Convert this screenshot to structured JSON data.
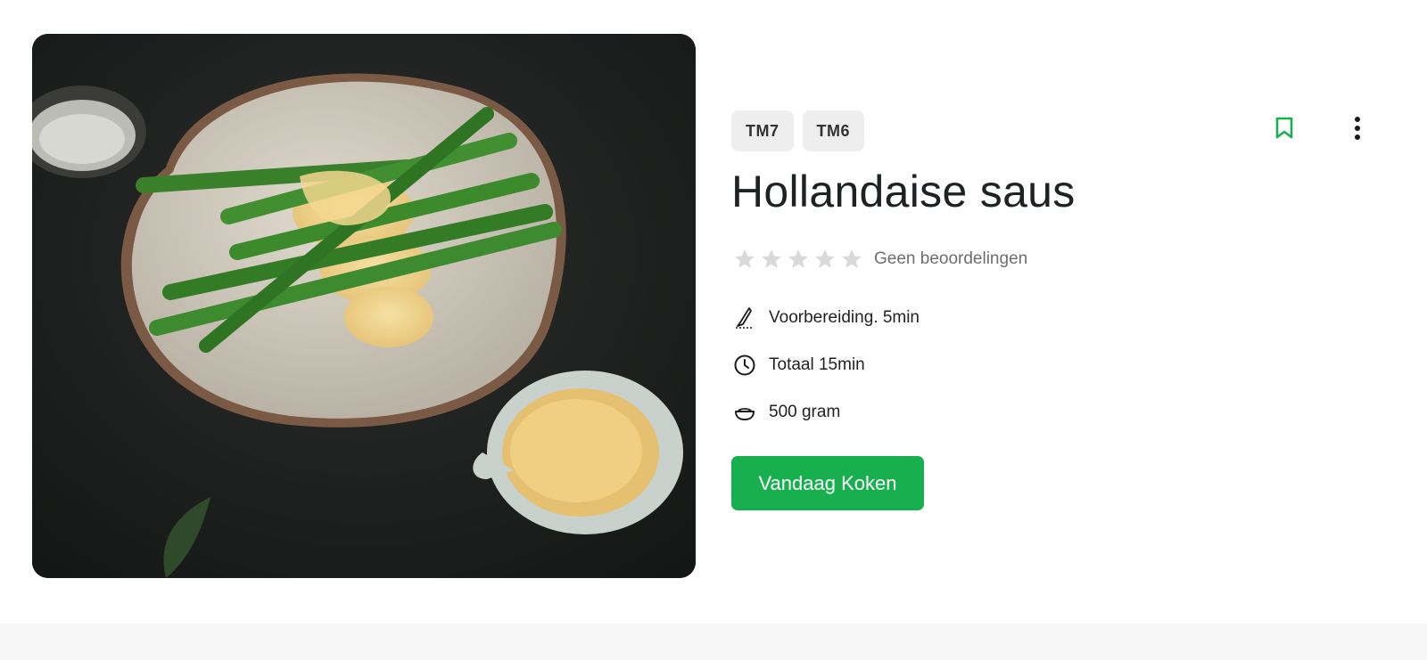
{
  "hero_image": {
    "alt": "Hollandaise saus",
    "colors": {
      "background": "#1d1f1e",
      "plate": "#d9d2c6",
      "asparagus": "#3f8a2e",
      "sauce": "#f1d58e"
    }
  },
  "recipe": {
    "tags": [
      "TM7",
      "TM6"
    ],
    "title": "Hollandaise saus",
    "rating": {
      "stars": 0,
      "max": 5,
      "text": "Geen beoordelingen"
    },
    "prep_time": "Voorbereiding. 5min",
    "total_time": "Totaal 15min",
    "yield": "500 gram",
    "cook_button": "Vandaag Koken"
  },
  "icons": {
    "bookmark": "bookmark-icon",
    "more": "more-vertical-icon",
    "prep": "knife-icon",
    "total": "clock-icon",
    "yield": "bowl-icon"
  },
  "colors": {
    "accent": "#18b04f",
    "star_empty": "#d9d9d9",
    "tag_bg": "#eeeeee"
  }
}
